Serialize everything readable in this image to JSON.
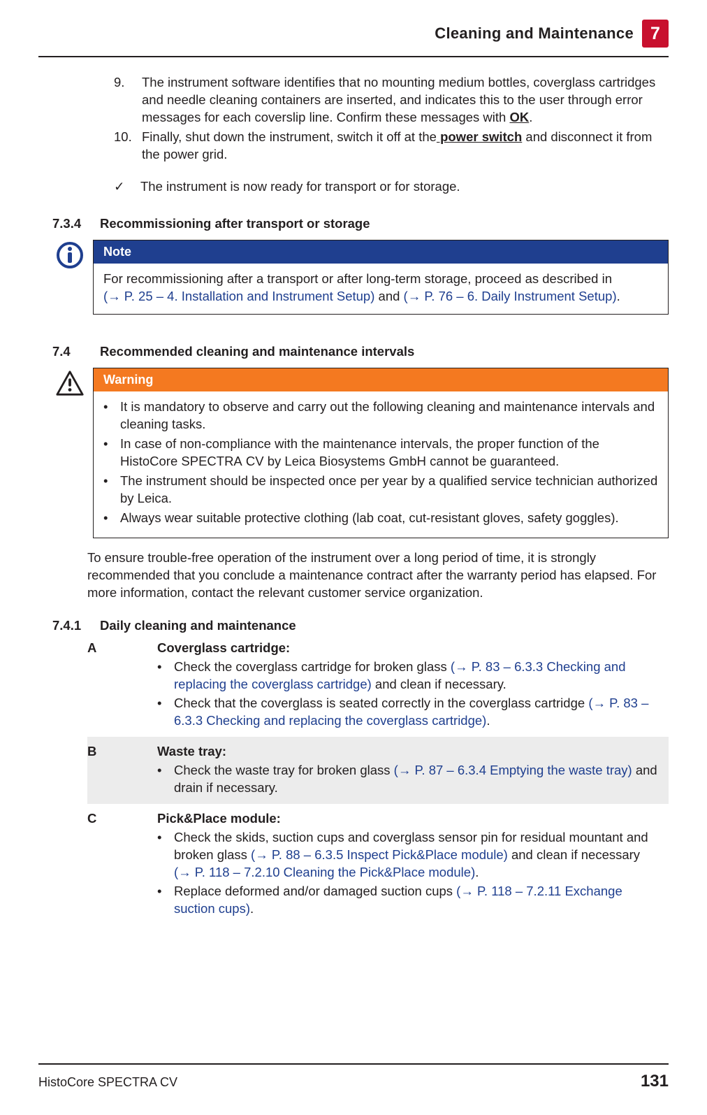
{
  "header": {
    "title": "Cleaning and Maintenance",
    "chapter": "7"
  },
  "ol": {
    "item9_num": "9.",
    "item9_text_a": "The instrument software identifies that no mounting medium bottles, coverglass cartridges and needle cleaning containers are inserted, and indicates this to the user through error messages for each coverslip line. Confirm these messages with ",
    "item9_ok": "OK",
    "item9_text_b": ".",
    "item10_num": "10.",
    "item10_text_a": "Finally, shut down the instrument, switch it off at the",
    "item10_ps": " power switch",
    "item10_text_b": " and disconnect it from the power grid."
  },
  "check": {
    "mark": "✓",
    "text": "The instrument is now ready for transport or for storage."
  },
  "s734": {
    "num": "7.3.4",
    "title": "Recommissioning after transport or storage",
    "note_label": "Note",
    "note_a": "For recommissioning after a transport or after long-term storage, proceed as described in ",
    "note_link1": "(→ P. 25 – 4. Installation and Instrument Setup)",
    "note_mid": " and ",
    "note_link2": "(→ P. 76 – 6. Daily Instrument Setup)",
    "note_end": "."
  },
  "s74": {
    "num": "7.4",
    "title": "Recommended cleaning and maintenance intervals",
    "warn_label": "Warning",
    "wb1": "It is mandatory to observe and carry out the following cleaning and maintenance intervals and cleaning tasks.",
    "wb2": "In case of non-compliance with the maintenance intervals, the proper function of the HistoCore SPECTRA CV by Leica Biosystems GmbH cannot be guaranteed.",
    "wb3": "The instrument should be inspected once per year by a qualified service technician authorized by Leica.",
    "wb4": "Always wear suitable protective clothing (lab coat, cut-resistant gloves, safety goggles).",
    "para": "To ensure trouble-free operation of the instrument over a long period of time, it is strongly recommended that you conclude a maintenance contract after the warranty period has elapsed. For more information, contact the relevant customer service organization."
  },
  "s741": {
    "num": "7.4.1",
    "title": "Daily cleaning and maintenance",
    "A_letter": "A",
    "A_title": "Coverglass cartridge:",
    "A1a": "Check the coverglass cartridge for broken glass ",
    "A1link": "(→ P. 83 – 6.3.3 Checking and replacing the coverglass cartridge)",
    "A1b": " and clean if necessary.",
    "A2a": "Check that the coverglass is seated correctly in the coverglass cartridge ",
    "A2link": "(→ P. 83 – 6.3.3 Checking and replacing the coverglass cartridge)",
    "A2b": ".",
    "B_letter": "B",
    "B_title": "Waste tray:",
    "B1a": "Check the waste tray for broken glass ",
    "B1link": "(→ P. 87 – 6.3.4 Emptying the waste tray)",
    "B1b": " and drain if necessary.",
    "C_letter": "C",
    "C_title": "Pick&Place module:",
    "C1a": "Check the skids, suction cups and coverglass sensor pin for residual mountant and broken glass ",
    "C1link1": "(→ P. 88 – 6.3.5 Inspect Pick&Place module)",
    "C1mid": " and clean if necessary ",
    "C1link2": "(→ P. 118 – 7.2.10 Cleaning the Pick&Place module)",
    "C1b": ".",
    "C2a": "Replace deformed and/or damaged suction cups ",
    "C2link": "(→ P. 118 – 7.2.11 Exchange suction cups)",
    "C2b": "."
  },
  "footer": {
    "product": "HistoCore SPECTRA CV",
    "page": "131"
  }
}
